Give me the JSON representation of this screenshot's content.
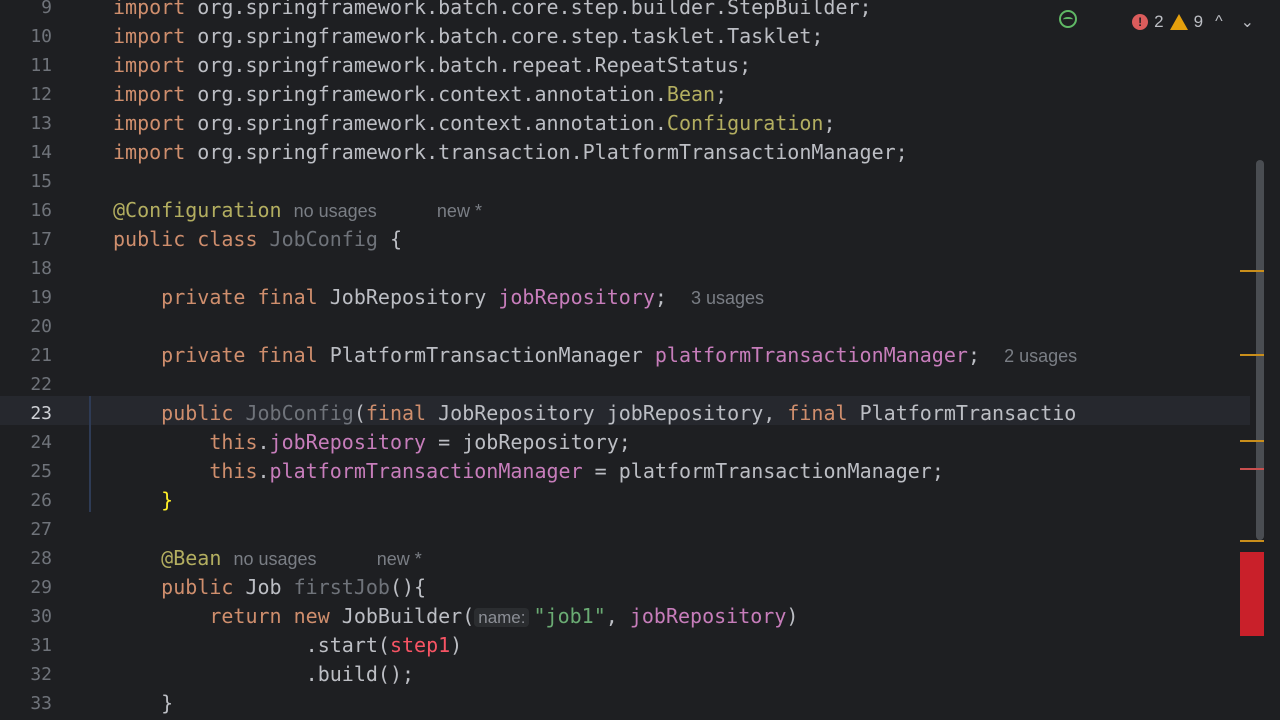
{
  "inspections": {
    "error_count": "2",
    "warning_count": "9",
    "prev_label": "^",
    "next_label": "⌄"
  },
  "lines": [
    {
      "num": "9",
      "tokens": [
        {
          "c": "kw",
          "t": "import "
        },
        {
          "c": "",
          "t": "org.springframework.batch.core.step.builder.StepBuilder;"
        }
      ]
    },
    {
      "num": "10",
      "tokens": [
        {
          "c": "kw",
          "t": "import "
        },
        {
          "c": "",
          "t": "org.springframework.batch.core.step.tasklet.Tasklet;"
        }
      ]
    },
    {
      "num": "11",
      "tokens": [
        {
          "c": "kw",
          "t": "import "
        },
        {
          "c": "",
          "t": "org.springframework.batch.repeat.RepeatStatus;"
        }
      ]
    },
    {
      "num": "12",
      "tokens": [
        {
          "c": "kw",
          "t": "import "
        },
        {
          "c": "",
          "t": "org.springframework.context.annotation."
        },
        {
          "c": "ann",
          "t": "Bean"
        },
        {
          "c": "",
          "t": ";"
        }
      ]
    },
    {
      "num": "13",
      "tokens": [
        {
          "c": "kw",
          "t": "import "
        },
        {
          "c": "",
          "t": "org.springframework.context.annotation."
        },
        {
          "c": "ann",
          "t": "Configuration"
        },
        {
          "c": "",
          "t": ";"
        }
      ]
    },
    {
      "num": "14",
      "tokens": [
        {
          "c": "kw",
          "t": "import "
        },
        {
          "c": "",
          "t": "org.springframework.transaction.PlatformTransactionManager;"
        }
      ]
    },
    {
      "num": "15",
      "tokens": []
    },
    {
      "num": "16",
      "tokens": [
        {
          "c": "ann",
          "t": "@Configuration"
        },
        {
          "c": "",
          "t": " "
        },
        {
          "c": "hint",
          "t": "no usages"
        },
        {
          "c": "",
          "t": "     "
        },
        {
          "c": "hint",
          "t": "new *"
        }
      ]
    },
    {
      "num": "17",
      "tokens": [
        {
          "c": "kw",
          "t": "public class "
        },
        {
          "c": "unused",
          "t": "JobConfig"
        },
        {
          "c": "",
          "t": " {"
        }
      ]
    },
    {
      "num": "18",
      "tokens": []
    },
    {
      "num": "19",
      "tokens": [
        {
          "c": "",
          "t": "    "
        },
        {
          "c": "kw",
          "t": "private final "
        },
        {
          "c": "",
          "t": "JobRepository "
        },
        {
          "c": "field",
          "t": "jobRepository"
        },
        {
          "c": "",
          "t": ";  "
        },
        {
          "c": "hint",
          "t": "3 usages"
        }
      ]
    },
    {
      "num": "20",
      "tokens": []
    },
    {
      "num": "21",
      "tokens": [
        {
          "c": "",
          "t": "    "
        },
        {
          "c": "kw",
          "t": "private final "
        },
        {
          "c": "",
          "t": "PlatformTransactionManager "
        },
        {
          "c": "field",
          "t": "platformTransactionManager"
        },
        {
          "c": "",
          "t": ";  "
        },
        {
          "c": "hint",
          "t": "2 usages"
        }
      ]
    },
    {
      "num": "22",
      "tokens": []
    },
    {
      "num": "23",
      "current": true,
      "tokens": [
        {
          "c": "",
          "t": "    "
        },
        {
          "c": "kw",
          "t": "public "
        },
        {
          "c": "unused",
          "t": "JobConfig"
        },
        {
          "c": "",
          "t": "("
        },
        {
          "c": "kw",
          "t": "final "
        },
        {
          "c": "",
          "t": "JobRepository jobRepository, "
        },
        {
          "c": "kw",
          "t": "final "
        },
        {
          "c": "",
          "t": "PlatformTransactio"
        }
      ]
    },
    {
      "num": "24",
      "tokens": [
        {
          "c": "",
          "t": "        "
        },
        {
          "c": "kw",
          "t": "this"
        },
        {
          "c": "",
          "t": "."
        },
        {
          "c": "field",
          "t": "jobRepository"
        },
        {
          "c": "",
          "t": " = jobRepository;"
        }
      ]
    },
    {
      "num": "25",
      "tokens": [
        {
          "c": "",
          "t": "        "
        },
        {
          "c": "kw",
          "t": "this"
        },
        {
          "c": "",
          "t": "."
        },
        {
          "c": "field",
          "t": "platformTransactionManager"
        },
        {
          "c": "",
          "t": " = platformTransactionManager;"
        }
      ]
    },
    {
      "num": "26",
      "tokens": [
        {
          "c": "",
          "t": "    "
        },
        {
          "c": "brace-hl",
          "t": "}"
        }
      ]
    },
    {
      "num": "27",
      "tokens": []
    },
    {
      "num": "28",
      "tokens": [
        {
          "c": "",
          "t": "    "
        },
        {
          "c": "ann",
          "t": "@Bean"
        },
        {
          "c": "",
          "t": " "
        },
        {
          "c": "hint",
          "t": "no usages"
        },
        {
          "c": "",
          "t": "     "
        },
        {
          "c": "hint",
          "t": "new *"
        }
      ]
    },
    {
      "num": "29",
      "tokens": [
        {
          "c": "",
          "t": "    "
        },
        {
          "c": "kw",
          "t": "public "
        },
        {
          "c": "",
          "t": "Job "
        },
        {
          "c": "unused",
          "t": "firstJob"
        },
        {
          "c": "",
          "t": "(){"
        }
      ]
    },
    {
      "num": "30",
      "tokens": [
        {
          "c": "",
          "t": "        "
        },
        {
          "c": "kw",
          "t": "return new "
        },
        {
          "c": "",
          "t": "JobBuilder("
        },
        {
          "c": "param-hint",
          "t": "name:"
        },
        {
          "c": "str",
          "t": "\"job1\""
        },
        {
          "c": "",
          "t": ", "
        },
        {
          "c": "field",
          "t": "jobRepository"
        },
        {
          "c": "",
          "t": ")"
        }
      ]
    },
    {
      "num": "31",
      "tokens": [
        {
          "c": "",
          "t": "                "
        },
        {
          "c": "",
          "t": ".start("
        },
        {
          "c": "err",
          "t": "step1"
        },
        {
          "c": "",
          "t": ")"
        }
      ]
    },
    {
      "num": "32",
      "tokens": [
        {
          "c": "",
          "t": "                "
        },
        {
          "c": "",
          "t": ".build();"
        }
      ]
    },
    {
      "num": "33",
      "tokens": [
        {
          "c": "",
          "t": "    "
        },
        {
          "c": "",
          "t": "}"
        }
      ]
    }
  ]
}
